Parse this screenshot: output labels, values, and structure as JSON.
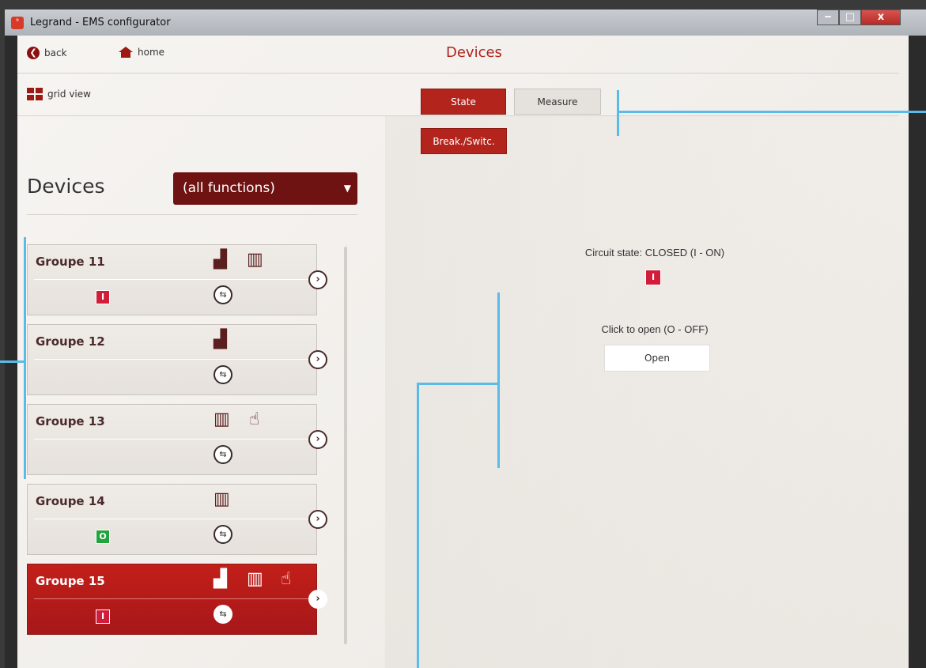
{
  "window": {
    "title": "Legrand - EMS configurator",
    "min": "‒",
    "max": "□",
    "close": "x"
  },
  "nav": {
    "back": "back",
    "home": "home",
    "page_title": "Devices"
  },
  "grid": {
    "label": "grid view"
  },
  "tabs": [
    {
      "label": "State",
      "active": true
    },
    {
      "label": "Measure",
      "active": false
    }
  ],
  "sub_tab": "Break./Switc.",
  "left": {
    "heading": "Devices",
    "filter": "(all functions)"
  },
  "devices": [
    {
      "name": "Groupe  11",
      "status": "I",
      "icons": [
        "measure-icon",
        "traffic-light-icon"
      ]
    },
    {
      "name": "Groupe  12",
      "status": "",
      "icons": [
        "measure-icon"
      ]
    },
    {
      "name": "Groupe  13",
      "status": "",
      "icons": [
        "traffic-light-icon",
        "hand-icon"
      ]
    },
    {
      "name": "Groupe  14",
      "status": "O",
      "icons": [
        "traffic-light-icon"
      ]
    },
    {
      "name": "Groupe  15",
      "status": "I",
      "icons": [
        "measure-icon",
        "traffic-light-icon",
        "hand-icon"
      ],
      "active": true
    }
  ],
  "state": {
    "circuit_state": "Circuit state: CLOSED (I - ON)",
    "indicator": "I",
    "open_label": "Click to open (O - OFF)",
    "open_button": "Open"
  },
  "colors": {
    "accent": "#b3241c",
    "on": "#d11d3a",
    "off": "#22a43c",
    "annotation": "#5bbbe8"
  }
}
